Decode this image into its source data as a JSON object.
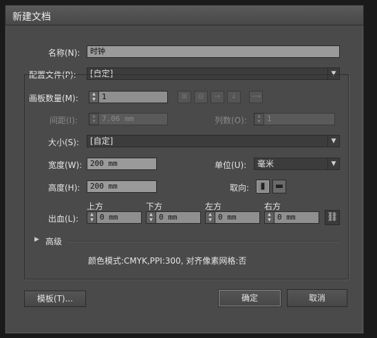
{
  "dialog": {
    "title": "新建文档"
  },
  "name": {
    "label": "名称(N):",
    "value": "时钟"
  },
  "profile": {
    "label": "配置文件(P):",
    "value": "[自定]"
  },
  "artboards": {
    "label": "画板数量(M):",
    "value": "1"
  },
  "spacing": {
    "label": "间距(I):",
    "value": "7.06 mm"
  },
  "columns": {
    "label": "列数(O):",
    "value": "1"
  },
  "size": {
    "label": "大小(S):",
    "value": "[自定]"
  },
  "width": {
    "label": "宽度(W):",
    "value": "200 mm"
  },
  "units": {
    "label": "单位(U):",
    "value": "毫米"
  },
  "height": {
    "label": "高度(H):",
    "value": "200 mm"
  },
  "orientation": {
    "label": "取向:"
  },
  "bleed": {
    "label": "出血(L):",
    "top_label": "上方",
    "top": "0 mm",
    "bottom_label": "下方",
    "bottom": "0 mm",
    "left_label": "左方",
    "left": "0 mm",
    "right_label": "右方",
    "right": "0 mm"
  },
  "advanced": {
    "label": "高级"
  },
  "summary": "颜色模式:CMYK,PPI:300, 对齐像素网格:否",
  "buttons": {
    "templates": "模板(T)...",
    "ok": "确定",
    "cancel": "取消"
  },
  "icons": {
    "grid_by_row": "grid-by-row-icon",
    "grid_by_column": "grid-by-column-icon",
    "arrange_by_row": "arrange-by-row-icon",
    "arrange_by_column": "arrange-by-column-icon",
    "change_to_rtl": "right-to-left-icon",
    "portrait": "portrait-icon",
    "landscape": "landscape-icon",
    "link": "chain-link-icon",
    "expand": "triangle-right-icon"
  },
  "colors": {
    "dialog_bg": "#4a4a4a",
    "field_bg": "#8f8f8f",
    "dark_bg": "#1a1a1a"
  }
}
